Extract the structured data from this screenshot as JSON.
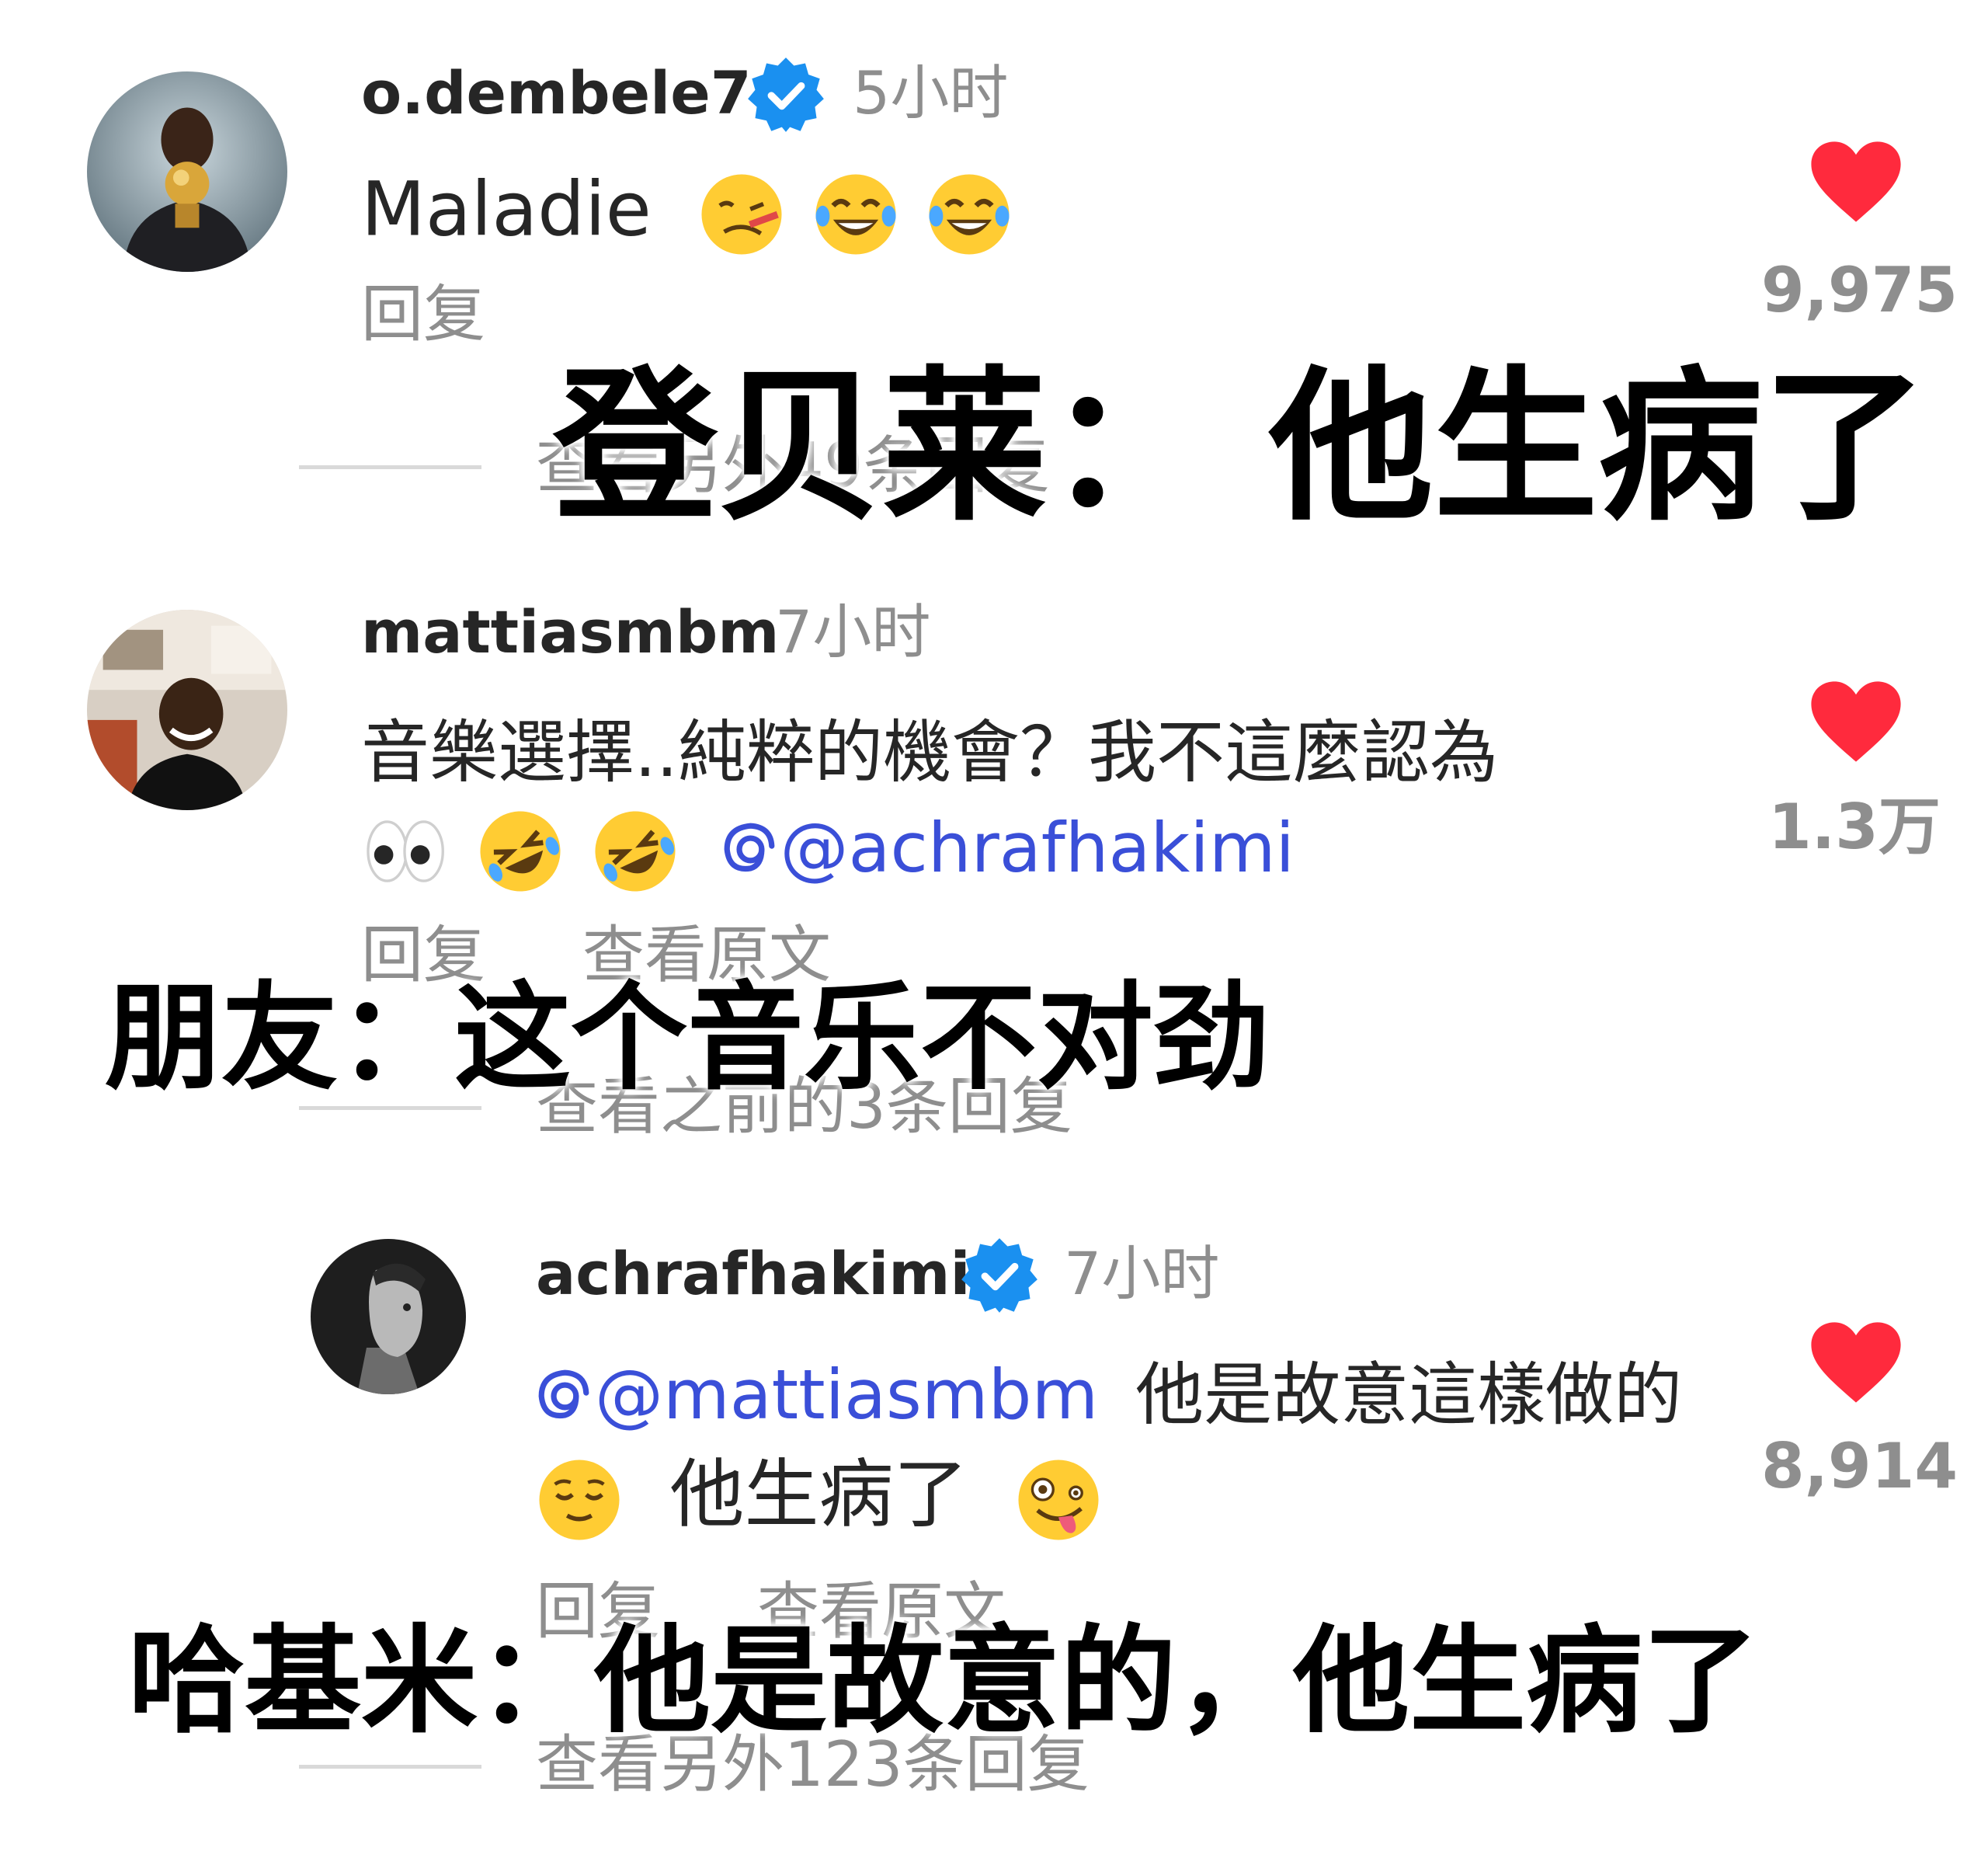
{
  "comments": [
    {
      "username": "o.dembele7",
      "verified": true,
      "time": "5小时",
      "text": "Maladie",
      "emojis": [
        "woozy-face",
        "tears-of-joy",
        "tears-of-joy"
      ],
      "reply_label": "回复",
      "like_count": "9,975",
      "more_replies": "查看另外49条回复"
    },
    {
      "username": "mattiasmbm",
      "verified": false,
      "time": "7小时",
      "text_line1": "音樂選擇..純粹的機會？我不這麼認為",
      "emojis": [
        "eyes",
        "rolling-laughing",
        "rolling-laughing"
      ],
      "mention": "@achrafhakimi",
      "reply_label": "回复",
      "translate_label": "查看原文",
      "like_count": "1.3万",
      "more_replies": "查看之前的3条回复"
    },
    {
      "username": "achrafhakimi",
      "verified": true,
      "time": "7小时",
      "mention": "@mattiasmbm",
      "text_line1": "他是故意這樣做的",
      "text_line2": "他生病了",
      "emojis": [
        "relieved-face",
        "zany-face"
      ],
      "reply_label": "回复",
      "translate_label": "查看原文",
      "like_count": "8,914",
      "more_replies": "查看另外123条回复"
    }
  ],
  "captions": {
    "c1": "登贝莱：  他生病了",
    "c2": "朋友：这个音乐不对劲",
    "c3": "哈基米：他是故意的，他生病了"
  },
  "colors": {
    "heart": "#ff2a3d",
    "verified": "#1a90f0",
    "mention": "#3a4fd8",
    "muted": "#8e8e8e"
  }
}
